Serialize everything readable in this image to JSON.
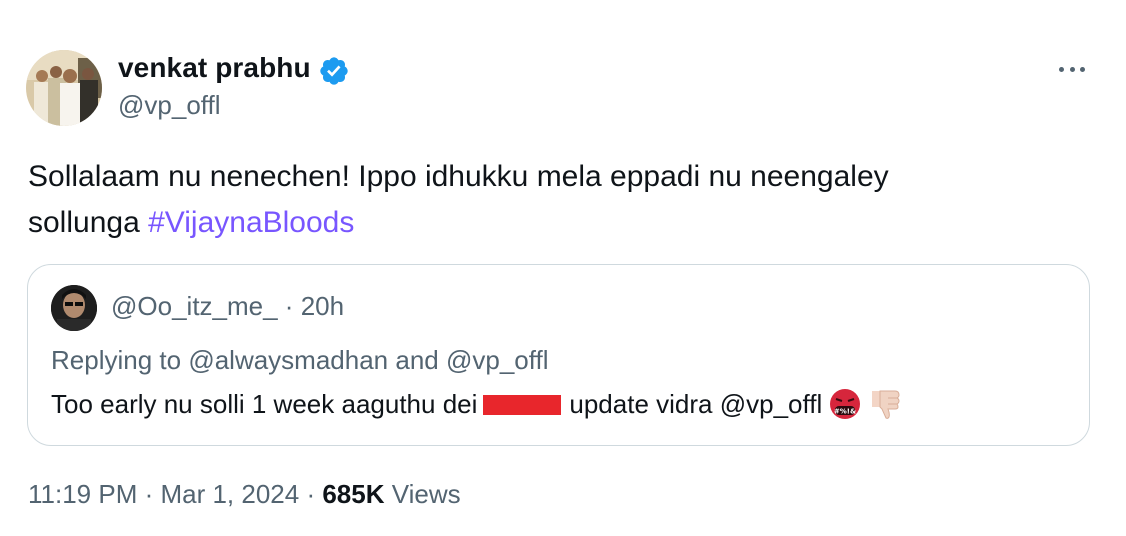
{
  "author": {
    "display_name": "venkat prabhu",
    "handle": "@vp_offl",
    "verified": true
  },
  "tweet": {
    "text_line_1": "Sollalaam nu nenechen! Ippo idhukku mela eppadi nu neengaley",
    "text_line_2_prefix": "sollunga ",
    "hashtag": "#VijaynaBloods"
  },
  "quoted_tweet": {
    "handle": "@Oo_itz_me_",
    "separator": " · ",
    "age": "20h",
    "replying_prefix": "Replying to ",
    "replying_user_1": "@alwaysmadhan",
    "replying_and": " and ",
    "replying_user_2": "@vp_offl",
    "text_before_redaction": "Too early nu solli 1 week aaguthu dei",
    "text_after_redaction": "update vidra @vp_offl",
    "emojis": [
      "face-with-symbols-on-mouth",
      "thumbs-down"
    ]
  },
  "meta": {
    "time": "11:19 PM",
    "date": "Mar 1, 2024",
    "separator": " · ",
    "views_count": "685K",
    "views_label": " Views"
  },
  "colors": {
    "text_primary": "#0f1419",
    "text_secondary": "#536471",
    "hashtag": "#7856ff",
    "verified": "#1d9bf0",
    "border": "#cfd9de",
    "redaction": "#e8262c"
  },
  "icons": {
    "verified": "verified-badge-icon",
    "more": "more-options-icon"
  }
}
